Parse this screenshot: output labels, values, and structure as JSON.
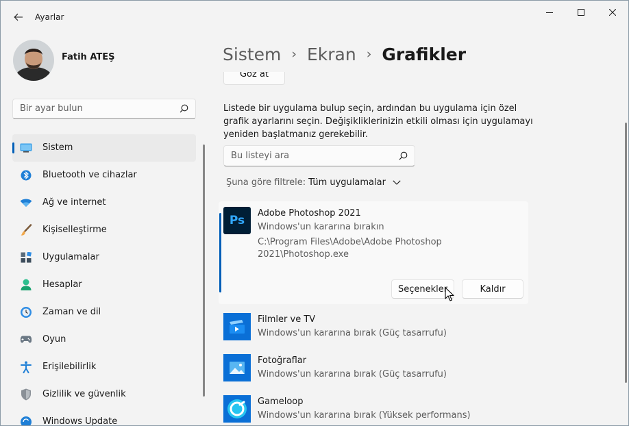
{
  "window": {
    "title": "Ayarlar"
  },
  "profile": {
    "name": "Fatih ATEŞ"
  },
  "sidebar": {
    "search_placeholder": "Bir ayar bulun",
    "items": [
      {
        "label": "Sistem",
        "icon": "system-icon",
        "active": true
      },
      {
        "label": "Bluetooth ve cihazlar",
        "icon": "bluetooth-icon"
      },
      {
        "label": "Ağ ve internet",
        "icon": "wifi-icon"
      },
      {
        "label": "Kişiselleştirme",
        "icon": "brush-icon"
      },
      {
        "label": "Uygulamalar",
        "icon": "apps-icon"
      },
      {
        "label": "Hesaplar",
        "icon": "account-icon"
      },
      {
        "label": "Zaman ve dil",
        "icon": "time-language-icon"
      },
      {
        "label": "Oyun",
        "icon": "gamepad-icon"
      },
      {
        "label": "Erişilebilirlik",
        "icon": "accessibility-icon"
      },
      {
        "label": "Gizlilik ve güvenlik",
        "icon": "shield-icon"
      },
      {
        "label": "Windows Update",
        "icon": "update-icon"
      }
    ]
  },
  "breadcrumb": {
    "items": [
      "Sistem",
      "Ekran"
    ],
    "separator": "›",
    "current": "Grafikler"
  },
  "main": {
    "browse_label": "Göz at",
    "description": "Listede bir uygulama bulup seçin, ardından bu uygulama için özel grafik ayarlarını seçin. Değişikliklerinizin etkili olması için uygulamayı yeniden başlatmanız gerekebilir.",
    "list_search_placeholder": "Bu listeyi ara",
    "filter": {
      "label": "Şuna göre filtrele:",
      "value": "Tüm uygulamalar"
    },
    "apps": [
      {
        "name": "Adobe Photoshop 2021",
        "preference": "Windows'un kararına bırakın",
        "path": "C:\\Program Files\\Adobe\\Adobe Photoshop 2021\\Photoshop.exe",
        "icon": "photoshop-icon",
        "icon_text": "Ps",
        "expanded": true
      },
      {
        "name": "Filmler ve TV",
        "preference": "Windows'un kararına bırak (Güç tasarrufu)",
        "icon": "movies-tv-icon"
      },
      {
        "name": "Fotoğraflar",
        "preference": "Windows'un kararına bırak (Güç tasarrufu)",
        "icon": "photos-icon"
      },
      {
        "name": "Gameloop",
        "preference": "Windows'un kararına bırak (Yüksek performans)",
        "icon": "gameloop-icon"
      }
    ],
    "options_label": "Seçenekler",
    "remove_label": "Kaldır"
  },
  "colors": {
    "accent": "#005fb8",
    "background": "#f3f3f3",
    "card": "#f9f9f9",
    "photoshop": "#001e36",
    "photoshop_text": "#31a8ff"
  }
}
